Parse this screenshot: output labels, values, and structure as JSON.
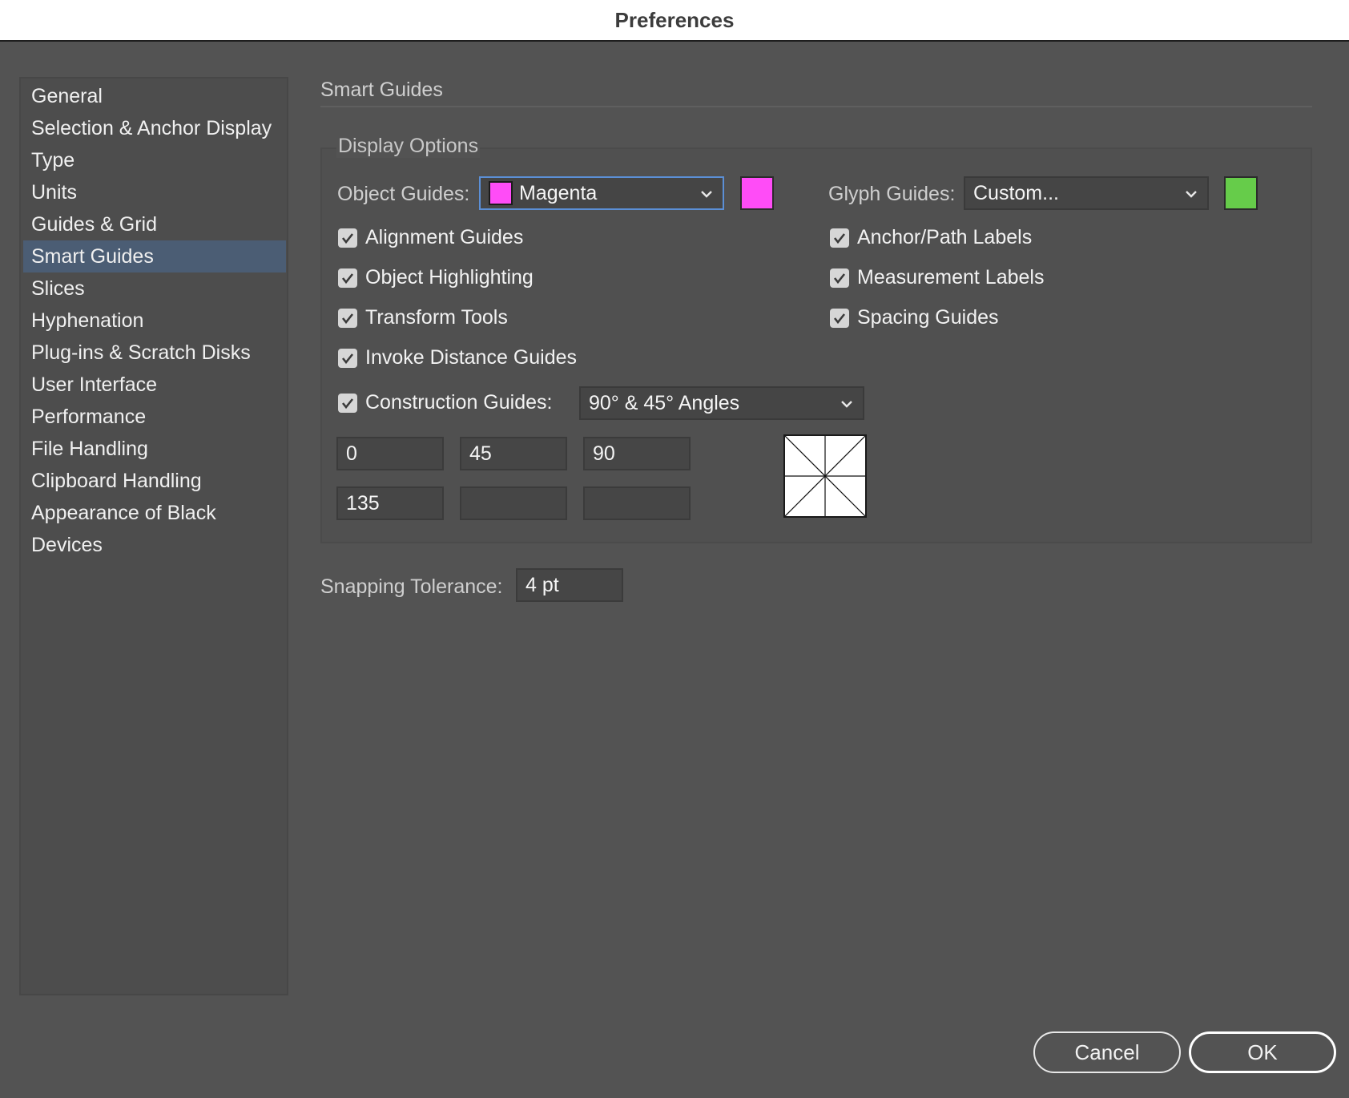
{
  "window": {
    "title": "Preferences"
  },
  "sidebar": {
    "items": [
      {
        "label": "General"
      },
      {
        "label": "Selection & Anchor Display"
      },
      {
        "label": "Type"
      },
      {
        "label": "Units"
      },
      {
        "label": "Guides & Grid"
      },
      {
        "label": "Smart Guides",
        "selected": true
      },
      {
        "label": "Slices"
      },
      {
        "label": "Hyphenation"
      },
      {
        "label": "Plug-ins & Scratch Disks"
      },
      {
        "label": "User Interface"
      },
      {
        "label": "Performance"
      },
      {
        "label": "File Handling"
      },
      {
        "label": "Clipboard Handling"
      },
      {
        "label": "Appearance of Black"
      },
      {
        "label": "Devices"
      }
    ]
  },
  "main": {
    "title": "Smart Guides",
    "display_options": {
      "label": "Display Options",
      "object_guides": {
        "label": "Object Guides:",
        "value": "Magenta",
        "color": "#ff4cf7"
      },
      "glyph_guides": {
        "label": "Glyph Guides:",
        "value": "Custom...",
        "color": "#66cc4a"
      },
      "checkboxes_left": [
        {
          "label": "Alignment Guides",
          "checked": true
        },
        {
          "label": "Object Highlighting",
          "checked": true
        },
        {
          "label": "Transform Tools",
          "checked": true
        },
        {
          "label": "Invoke Distance Guides",
          "checked": true
        }
      ],
      "checkboxes_right": [
        {
          "label": "Anchor/Path Labels",
          "checked": true
        },
        {
          "label": "Measurement Labels",
          "checked": true
        },
        {
          "label": "Spacing Guides",
          "checked": true
        }
      ],
      "construction_guides": {
        "label": "Construction Guides:",
        "checked": true,
        "value": "90° & 45° Angles"
      },
      "angles": [
        "0",
        "45",
        "90",
        "135",
        "",
        ""
      ]
    },
    "snapping_tolerance": {
      "label": "Snapping Tolerance:",
      "value": "4 pt"
    }
  },
  "buttons": {
    "cancel": "Cancel",
    "ok": "OK"
  },
  "icons": {
    "checkbox": "checkmark-icon",
    "dropdown": "chevron-down-icon"
  }
}
